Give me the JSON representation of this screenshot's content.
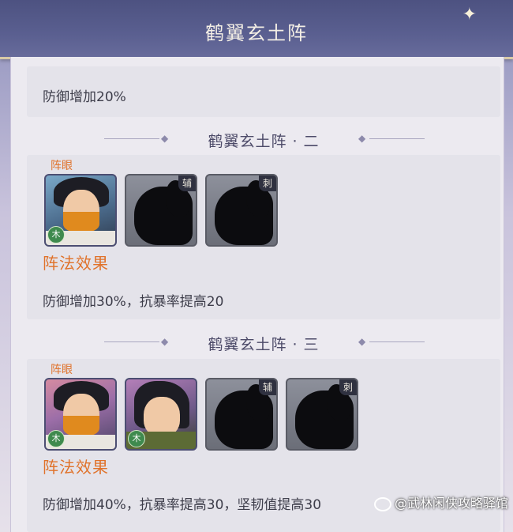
{
  "header": {
    "title": "鹤翼玄土阵",
    "sparkle_icon": "bird-sparkle-icon"
  },
  "tier1": {
    "effect_text": "防御增加20%"
  },
  "tier2": {
    "title": "鹤翼玄土阵 · 二",
    "eye_label": "阵眼",
    "slots": [
      {
        "type": "hero",
        "element": "木"
      },
      {
        "type": "empty",
        "role": "辅"
      },
      {
        "type": "empty",
        "role": "刺"
      }
    ],
    "effect_label": "阵法效果",
    "effect_text": "防御增加30%，抗暴率提高20"
  },
  "tier3": {
    "title": "鹤翼玄土阵 · 三",
    "eye_label": "阵眼",
    "slots": [
      {
        "type": "hero",
        "element": "木"
      },
      {
        "type": "hero",
        "element": "木"
      },
      {
        "type": "empty",
        "role": "辅"
      },
      {
        "type": "empty",
        "role": "刺"
      }
    ],
    "effect_label": "阵法效果",
    "effect_text": "防御增加40%，抗暴率提高30，坚韧值提高30"
  },
  "watermark": {
    "text": "@武林闲侠攻略驿馆"
  },
  "colors": {
    "accent": "#e0722a",
    "header_bg": "#4d5281",
    "card_bg": "#e4e3ea"
  }
}
